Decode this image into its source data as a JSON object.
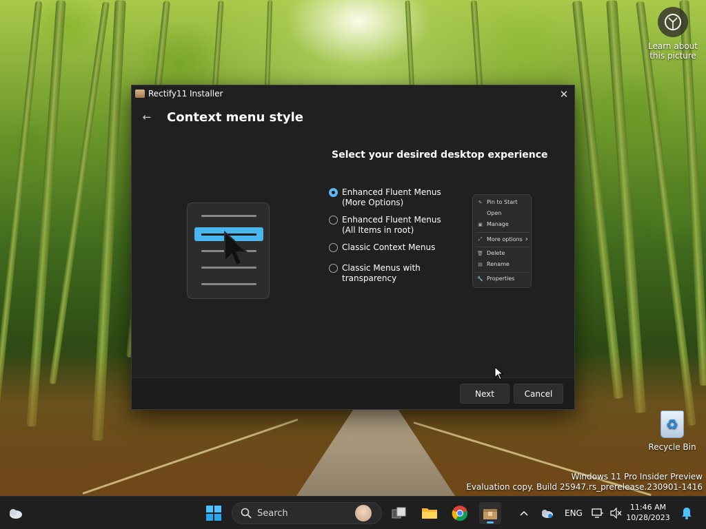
{
  "desktop": {
    "learn_label": "Learn about this picture",
    "recycle_bin_label": "Recycle Bin",
    "watermark_line1": "Windows 11 Pro Insider Preview",
    "watermark_line2": "Evaluation copy. Build 25947.rs_prerelease.230901-1416"
  },
  "window": {
    "title": "Rectify11 Installer",
    "close_label": "✕",
    "back_label": "←",
    "page_title": "Context menu style",
    "section_title": "Select your desired desktop experience",
    "options": [
      {
        "line1": "Enhanced Fluent Menus",
        "line2": "(More Options)",
        "selected": true
      },
      {
        "line1": "Enhanced Fluent Menus",
        "line2": "(All Items in root)",
        "selected": false
      },
      {
        "line1": "Classic Context Menus",
        "line2": "",
        "selected": false
      },
      {
        "line1": "Classic Menus with",
        "line2": "transparency",
        "selected": false
      }
    ],
    "preview": {
      "items": [
        "Pin to Start",
        "Open",
        "Manage",
        "More options",
        "Delete",
        "Rename",
        "Properties"
      ],
      "more_chevron": "›"
    },
    "buttons": {
      "next": "Next",
      "cancel": "Cancel"
    }
  },
  "taskbar": {
    "search_placeholder": "Search",
    "language": "ENG",
    "time": "11:46 AM",
    "date": "10/28/2023"
  },
  "colors": {
    "accent": "#5cb8f0",
    "window_bg": "#202020",
    "footer_bg": "#1b1b1b",
    "taskbar_bg": "#1f1f1f"
  },
  "icons": {
    "app": "rectify11-installer-icon",
    "learn": "camera-lens-icon",
    "recycle": "recycle-bin-icon",
    "start": "windows-logo-icon",
    "search": "search-icon"
  }
}
